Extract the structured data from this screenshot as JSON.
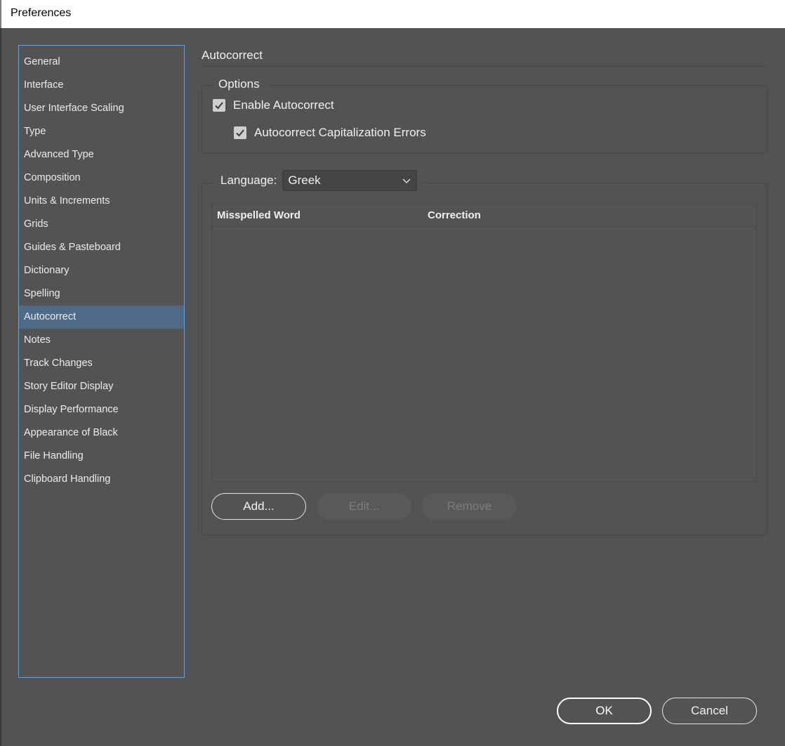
{
  "window": {
    "title": "Preferences"
  },
  "sidebar": {
    "items": [
      {
        "label": "General"
      },
      {
        "label": "Interface"
      },
      {
        "label": "User Interface Scaling"
      },
      {
        "label": "Type"
      },
      {
        "label": "Advanced Type"
      },
      {
        "label": "Composition"
      },
      {
        "label": "Units & Increments"
      },
      {
        "label": "Grids"
      },
      {
        "label": "Guides & Pasteboard"
      },
      {
        "label": "Dictionary"
      },
      {
        "label": "Spelling"
      },
      {
        "label": "Autocorrect"
      },
      {
        "label": "Notes"
      },
      {
        "label": "Track Changes"
      },
      {
        "label": "Story Editor Display"
      },
      {
        "label": "Display Performance"
      },
      {
        "label": "Appearance of Black"
      },
      {
        "label": "File Handling"
      },
      {
        "label": "Clipboard Handling"
      }
    ],
    "selected": "Autocorrect"
  },
  "panel": {
    "title": "Autocorrect",
    "options": {
      "legend": "Options",
      "enable_autocorrect": {
        "label": "Enable Autocorrect",
        "checked": true
      },
      "capitalization_errors": {
        "label": "Autocorrect Capitalization Errors",
        "checked": true
      }
    },
    "language": {
      "label": "Language:",
      "value": "Greek"
    },
    "table": {
      "columns": [
        "Misspelled Word",
        "Correction"
      ],
      "rows": []
    },
    "buttons": {
      "add": "Add...",
      "edit": "Edit...",
      "remove": "Remove"
    }
  },
  "footer": {
    "ok": "OK",
    "cancel": "Cancel"
  },
  "colors": {
    "background": "#535353",
    "selection": "#4f6a86",
    "sidebar_border": "#6f9fd3"
  }
}
